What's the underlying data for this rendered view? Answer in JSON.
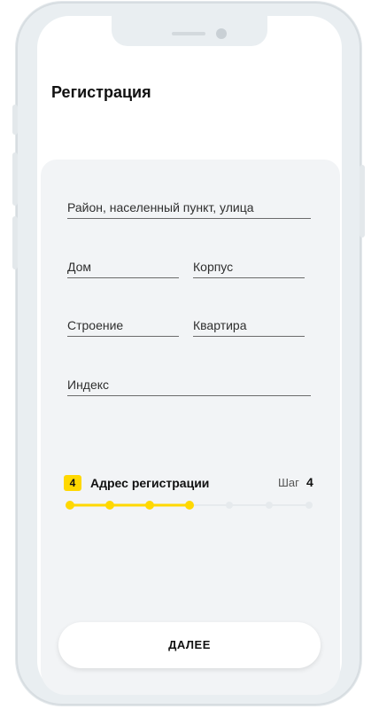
{
  "header": {
    "title": "Регистрация"
  },
  "form": {
    "address_placeholder": "Район, населенный пункт, улица",
    "house_placeholder": "Дом",
    "building_placeholder": "Корпус",
    "structure_placeholder": "Строение",
    "apartment_placeholder": "Квартира",
    "zip_placeholder": "Индекс"
  },
  "step": {
    "badge": "4",
    "label": "Адрес регистрации",
    "word": "Шаг",
    "number": "4",
    "total_dots": 7,
    "completed_dots": 4
  },
  "cta": {
    "label": "ДАЛЕЕ"
  },
  "colors": {
    "accent": "#ffd800",
    "inactive_dot": "#e6eaed",
    "card_bg": "#f2f4f6"
  }
}
